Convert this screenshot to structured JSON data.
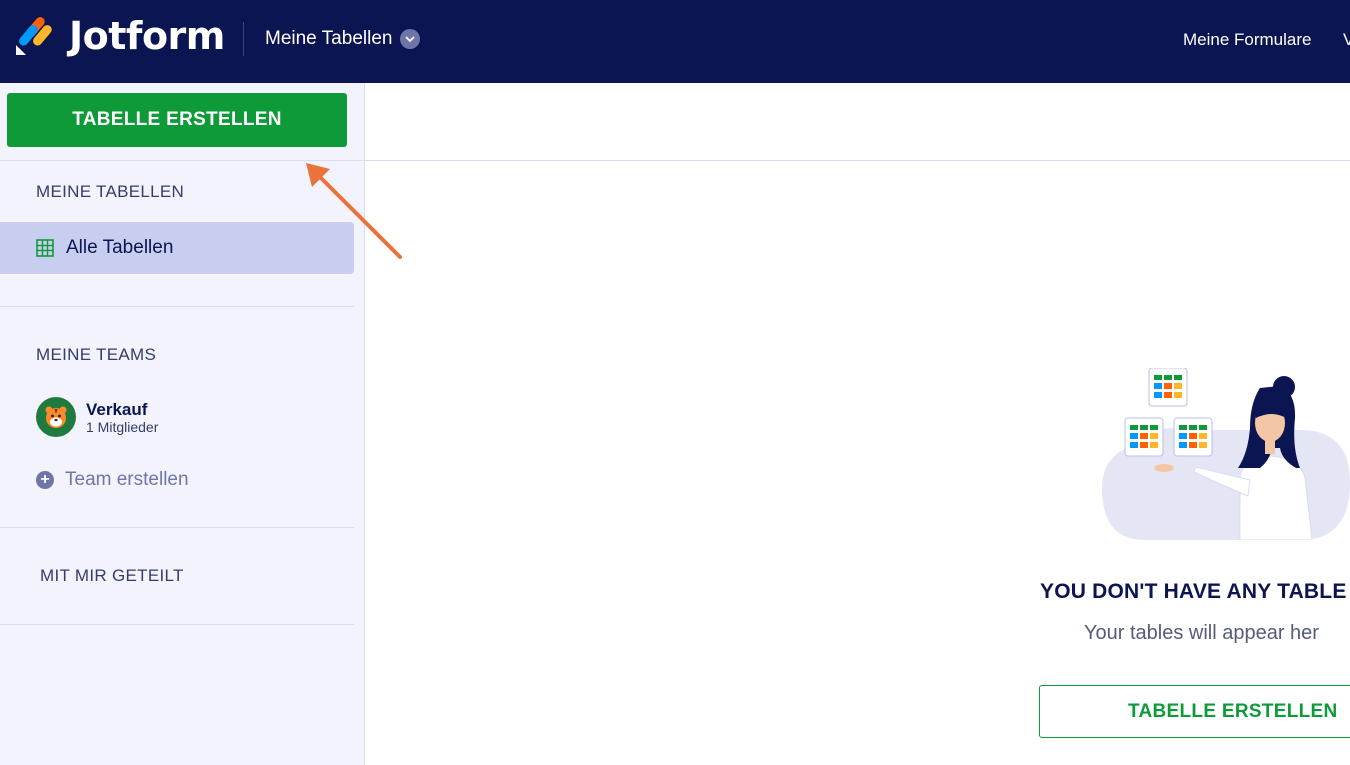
{
  "header": {
    "brand": "Jotform",
    "tables_menu_label": "Meine Tabellen",
    "my_forms_label": "Meine Formulare",
    "overflow_text": "V"
  },
  "sidebar": {
    "create_button_label": "TABELLE ERSTELLEN",
    "my_tables_heading": "MEINE TABELLEN",
    "all_tables_label": "Alle Tabellen",
    "my_teams_heading": "MEINE TEAMS",
    "team": {
      "name": "Verkauf",
      "members": "1 Mitglieder"
    },
    "create_team_label": "Team erstellen",
    "shared_with_me_heading": "MIT MIR GETEILT"
  },
  "main": {
    "empty_title": "YOU DON'T HAVE ANY TABLE",
    "empty_subtitle": "Your tables will appear her",
    "empty_button_label": "TABELLE ERSTELLEN"
  },
  "colors": {
    "topbar": "#0a1551",
    "primary_green": "#0f9a3a",
    "sidebar_bg": "#f3f3fe",
    "active_item": "#c8cef0",
    "annotation_arrow": "#e8743b"
  },
  "icons": [
    "jotform-logo-icon",
    "chevron-down-icon",
    "table-grid-icon",
    "tiger-avatar-icon",
    "plus-circle-icon",
    "annotation-arrow-icon"
  ]
}
